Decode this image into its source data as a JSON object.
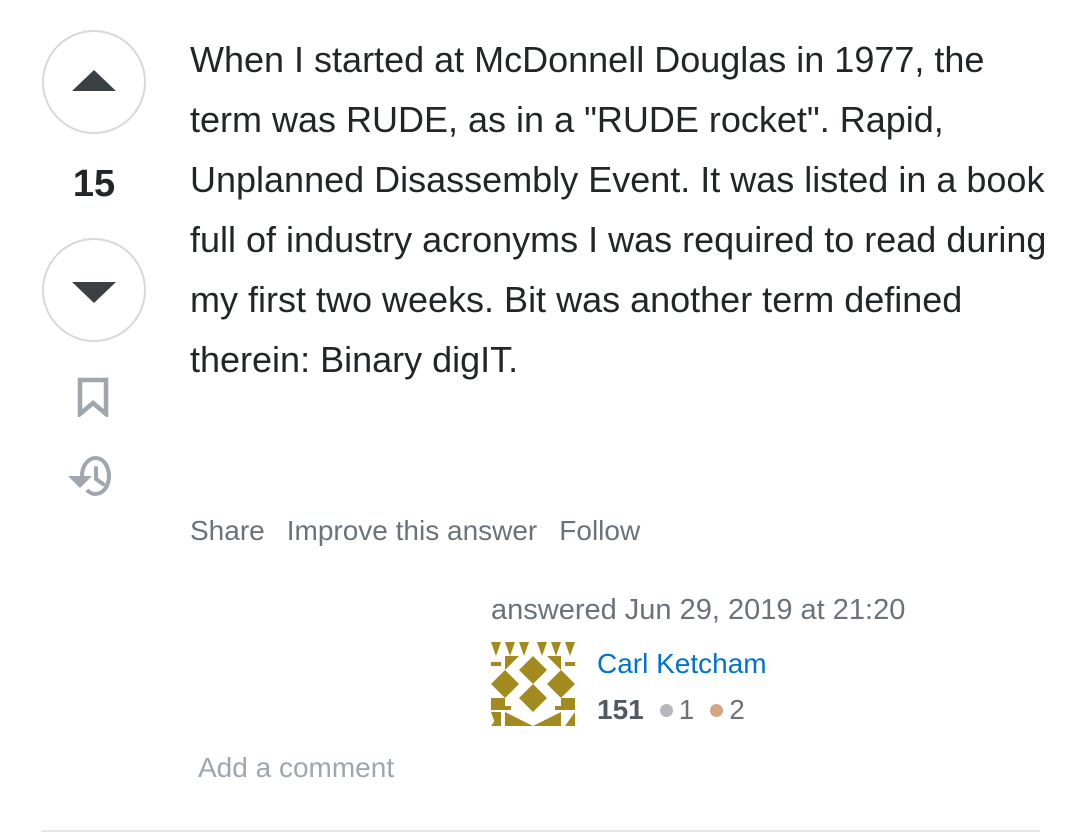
{
  "vote": {
    "score": "15"
  },
  "answer": {
    "text": "When I started at McDonnell Douglas in 1977, the term was RUDE, as in a \"RUDE rocket\". Rapid, Unplanned Disassembly Event. It was listed in a book full of industry acronyms I was required to read during my first two weeks. Bit was another term defined therein: Binary digIT."
  },
  "menu": {
    "share": "Share",
    "improve": "Improve this answer",
    "follow": "Follow"
  },
  "signature": {
    "answered": "answered Jun 29, 2019 at 21:20",
    "user_name": "Carl Ketcham",
    "reputation": "151",
    "silver_badges": "1",
    "bronze_badges": "2"
  },
  "comments": {
    "add_comment": "Add a comment"
  },
  "colors": {
    "silver_badge": "#b4b8bc",
    "bronze_badge": "#d1a684",
    "avatar_gold": "#a38a1e",
    "link_blue": "#0074cc"
  },
  "icons": {
    "upvote": "triangle-up-icon",
    "downvote": "triangle-down-icon",
    "bookmark": "bookmark-icon",
    "history": "history-icon"
  }
}
